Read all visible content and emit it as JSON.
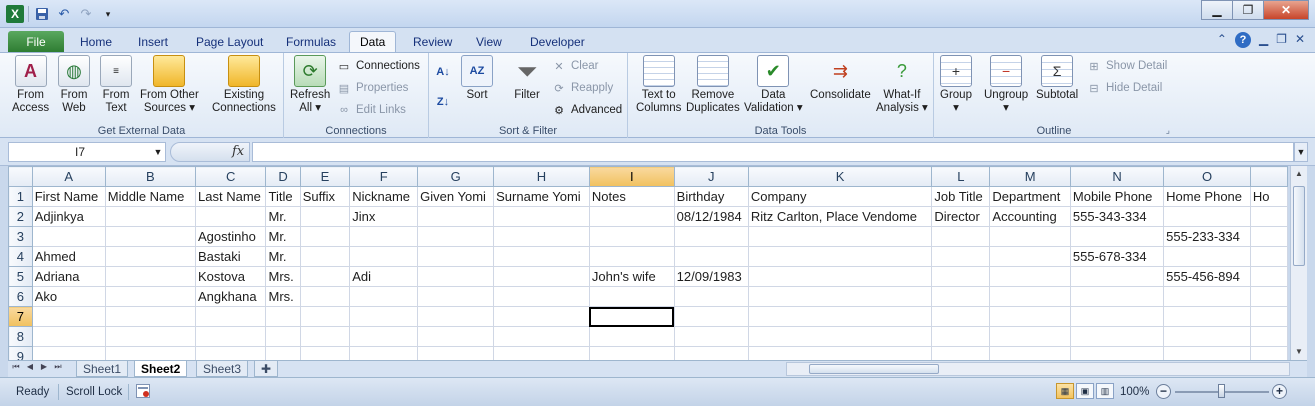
{
  "qat": {
    "logo": "X",
    "save_icon": "save-icon",
    "undo_icon": "undo-icon",
    "redo_icon": "redo-icon"
  },
  "window_controls": {
    "minimize": "▁",
    "restore": "❐",
    "close": "✕"
  },
  "tabs": {
    "file": "File",
    "home": "Home",
    "insert": "Insert",
    "page_layout": "Page Layout",
    "formulas": "Formulas",
    "data": "Data",
    "review": "Review",
    "view": "View",
    "developer": "Developer"
  },
  "ribbon": {
    "get_external_data": {
      "label": "Get External Data",
      "from_access": "From\nAccess",
      "from_web": "From\nWeb",
      "from_text": "From\nText",
      "from_other": "From Other\nSources ▾",
      "existing": "Existing\nConnections"
    },
    "connections": {
      "label": "Connections",
      "refresh_all": "Refresh\nAll ▾",
      "connections": "Connections",
      "properties": "Properties",
      "edit_links": "Edit Links"
    },
    "sort_filter": {
      "label": "Sort & Filter",
      "sort": "Sort",
      "filter": "Filter",
      "clear": "Clear",
      "reapply": "Reapply",
      "advanced": "Advanced"
    },
    "data_tools": {
      "label": "Data Tools",
      "text_to_columns": "Text to\nColumns",
      "remove_duplicates": "Remove\nDuplicates",
      "data_validation": "Data\nValidation ▾",
      "consolidate": "Consolidate",
      "what_if": "What-If\nAnalysis ▾"
    },
    "outline": {
      "label": "Outline",
      "group": "Group\n▾",
      "ungroup": "Ungroup\n▾",
      "subtotal": "Subtotal",
      "show_detail": "Show Detail",
      "hide_detail": "Hide Detail"
    }
  },
  "formula_bar": {
    "name_box": "I7",
    "fx": "fx",
    "content": ""
  },
  "grid": {
    "columns": [
      "A",
      "B",
      "C",
      "D",
      "E",
      "F",
      "G",
      "H",
      "I",
      "J",
      "K",
      "L",
      "M",
      "N",
      "O"
    ],
    "selected_column": "I",
    "row_numbers": [
      "1",
      "2",
      "3",
      "4",
      "5",
      "6",
      "7",
      "8",
      "9"
    ],
    "selected_row": "7",
    "rows": [
      [
        "First Name",
        "Middle Name",
        "Last Name",
        "Title",
        "Suffix",
        "Nickname",
        "Given Yomi",
        "Surname Yomi",
        "Notes",
        "Birthday",
        "Company",
        "Job Title",
        "Department",
        "Mobile Phone",
        "Home Phone",
        "Ho"
      ],
      [
        "Adjinkya",
        "",
        "",
        "Mr.",
        "",
        "Jinx",
        "",
        "",
        "",
        "08/12/1984",
        "Ritz Carlton, Place Vendome",
        "Director",
        "Accounting",
        "555-343-334",
        "",
        ""
      ],
      [
        "",
        "",
        "Agostinho",
        "Mr.",
        "",
        "",
        "",
        "",
        "",
        "",
        "",
        "",
        "",
        "",
        "555-233-334",
        ""
      ],
      [
        "Ahmed",
        "",
        "Bastaki",
        "Mr.",
        "",
        "",
        "",
        "",
        "",
        "",
        "",
        "",
        "",
        "555-678-334",
        "",
        ""
      ],
      [
        "Adriana",
        "",
        "Kostova",
        "Mrs.",
        "",
        "Adi",
        "",
        "",
        "John's wife",
        "12/09/1983",
        "",
        "",
        "",
        "",
        "555-456-894",
        ""
      ],
      [
        "Ako",
        "",
        "Angkhana",
        "Mrs.",
        "",
        "",
        "",
        "",
        "",
        "",
        "",
        "",
        "",
        "",
        "",
        ""
      ],
      [
        "",
        "",
        "",
        "",
        "",
        "",
        "",
        "",
        "",
        "",
        "",
        "",
        "",
        "",
        "",
        ""
      ],
      [
        "",
        "",
        "",
        "",
        "",
        "",
        "",
        "",
        "",
        "",
        "",
        "",
        "",
        "",
        "",
        ""
      ],
      [
        "",
        "",
        "",
        "",
        "",
        "",
        "",
        "",
        "",
        "",
        "",
        "",
        "",
        "",
        "",
        ""
      ]
    ]
  },
  "sheet_tabs": [
    "Sheet1",
    "Sheet2",
    "Sheet3"
  ],
  "active_sheet": "Sheet2",
  "status": {
    "ready": "Ready",
    "scroll_lock": "Scroll Lock",
    "zoom": "100%"
  }
}
